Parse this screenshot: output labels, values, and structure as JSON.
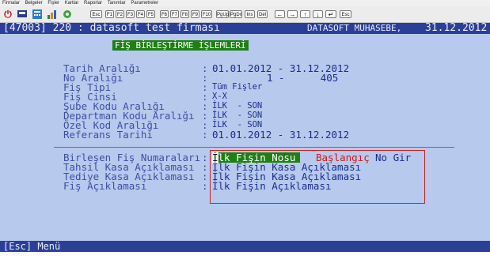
{
  "menu": [
    "Firmalar",
    "Belgeler",
    "Fişler",
    "Kartlar",
    "Raporlar",
    "Tanımlar",
    "Parametreler"
  ],
  "toolbar": {
    "keys": [
      "Esc",
      "F1",
      "F2",
      "F3",
      "F4",
      "F5",
      "F6",
      "F7",
      "F8",
      "F9",
      "F10",
      "PgUp",
      "PgDn",
      "Ins",
      "Del"
    ],
    "nav_keys": [
      "←",
      "→",
      "↑",
      "↓",
      "↵",
      "Esc"
    ]
  },
  "title": {
    "code": "[47003] 220 : datasoft test firması",
    "company": "DATASOFT MUHASEBE,",
    "date": "31.12.2012"
  },
  "form_title": "FİŞ BİRLEŞTİRME İŞLEMLERİ",
  "fields": [
    {
      "label": "Tarih Aralığı",
      "value": "01.01.2012 - 31.12.2012"
    },
    {
      "label": "No Aralığı",
      "value": "1 -      405"
    },
    {
      "label": "Fiş Tipi",
      "value": "Tüm Fişler"
    },
    {
      "label": "Fiş Cinsi",
      "value": "X-X"
    },
    {
      "label": "Şube Kodu Aralığı",
      "value": "İLK  - SON"
    },
    {
      "label": "Departman Kodu Aralığı",
      "value": "İLK  - SON"
    },
    {
      "label": "Özel Kod Aralığı",
      "value": "İLK  - SON"
    },
    {
      "label": "Referans Tarihi",
      "value": "01.01.2012 - 31.12.2012"
    }
  ],
  "merge_fields": [
    {
      "label": "Birleşen Fiş Numaraları",
      "value": "İlk Fişin Nosu"
    },
    {
      "label": "Tahsil Kasa Açıklaması",
      "value": "İlk Fişin Kasa Açıklaması"
    },
    {
      "label": "Tediye Kasa Açıklaması",
      "value": "İlk Fişin Kasa Açıklaması"
    },
    {
      "label": "Fiş Açıklaması",
      "value": "İlk Fişin Açıklaması"
    }
  ],
  "selected_option": {
    "cursor": "İ",
    "rest": "lk Fişin Nosu"
  },
  "option_alt": "Başlangıç",
  "option_alt2": "No Gir",
  "separator": ":",
  "status": "[Esc] Menü"
}
